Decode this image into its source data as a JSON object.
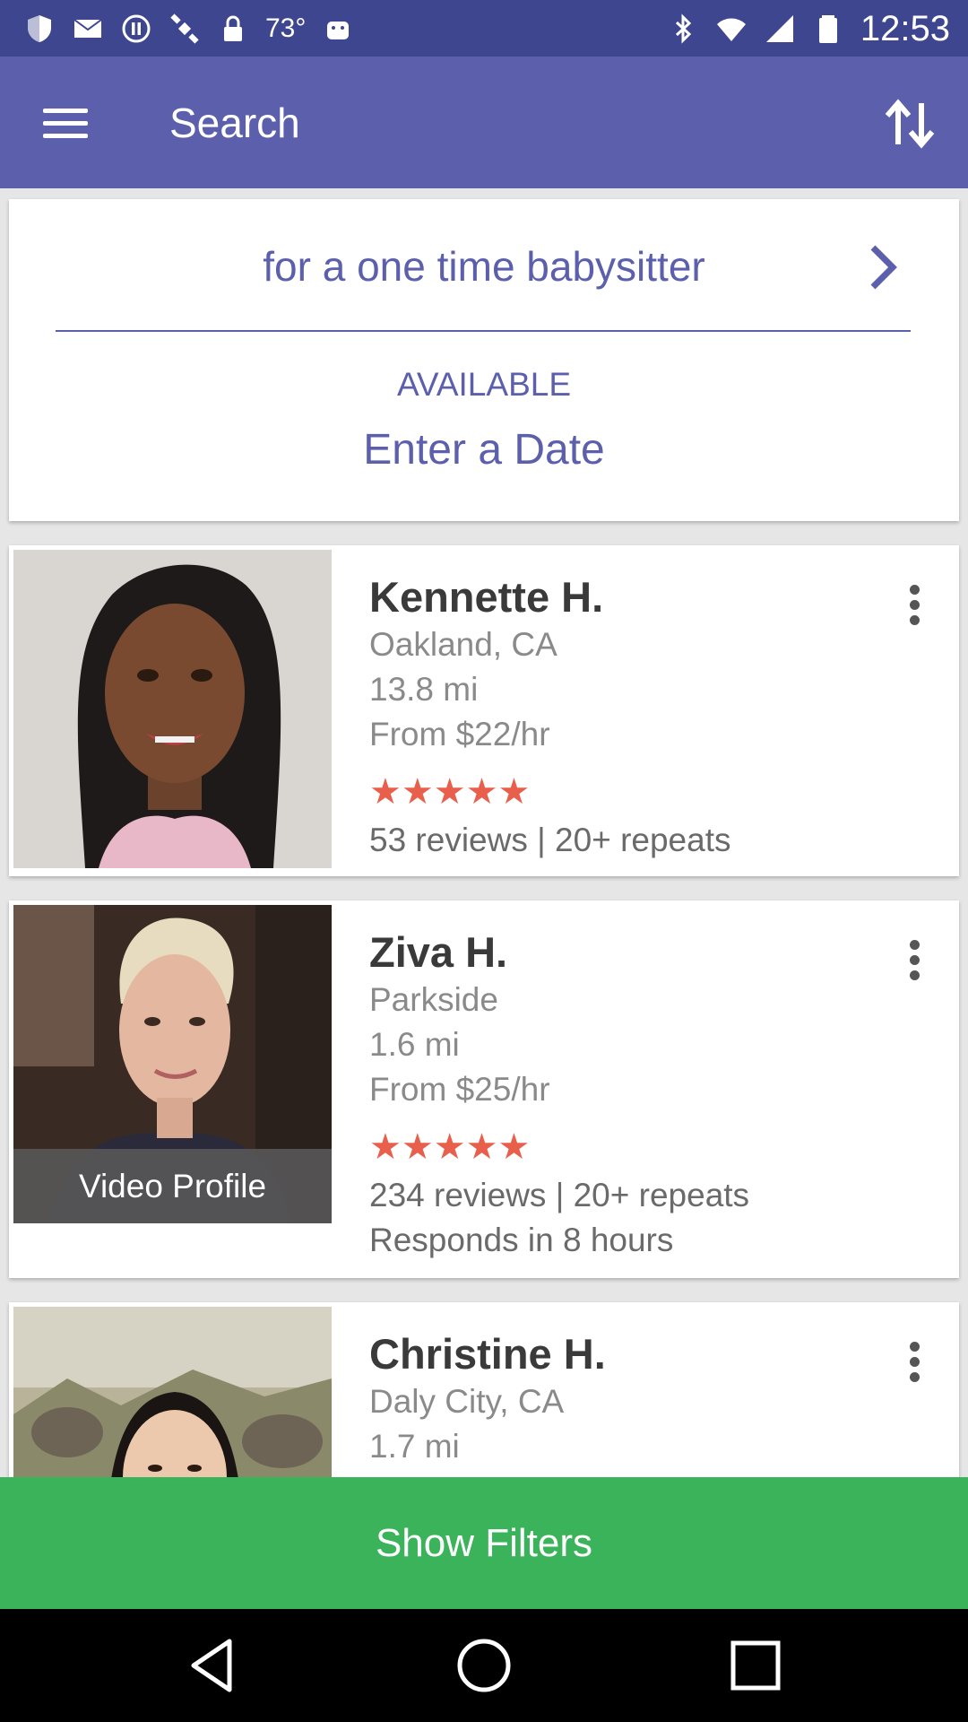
{
  "status_bar": {
    "temperature": "73°",
    "time": "12:53"
  },
  "toolbar": {
    "title": "Search",
    "menu_icon": "hamburger-menu-icon",
    "sort_icon": "sort-arrows-icon"
  },
  "search": {
    "care_type": "for a one time babysitter",
    "available_label": "AVAILABLE",
    "date_value": "Enter a Date"
  },
  "sitters": [
    {
      "name": "Kennette H.",
      "location": "Oakland, CA",
      "distance": "13.8 mi",
      "rate": "From $22/hr",
      "stars": "★★★★★",
      "reviews": "53 reviews | 20+ repeats"
    },
    {
      "name": "Ziva H.",
      "location": "Parkside",
      "distance": "1.6 mi",
      "rate": "From $25/hr",
      "stars": "★★★★★",
      "reviews": "234 reviews | 20+ repeats",
      "response": "Responds in 8 hours",
      "video_label": "Video Profile"
    },
    {
      "name": "Christine H.",
      "location": "Daly City, CA",
      "distance": "1.7 mi"
    }
  ],
  "filters_button": "Show Filters",
  "colors": {
    "primary": "#5b5fac",
    "status_bar": "#3e4690",
    "accent_green": "#3bb35a",
    "star": "#e8604c"
  }
}
